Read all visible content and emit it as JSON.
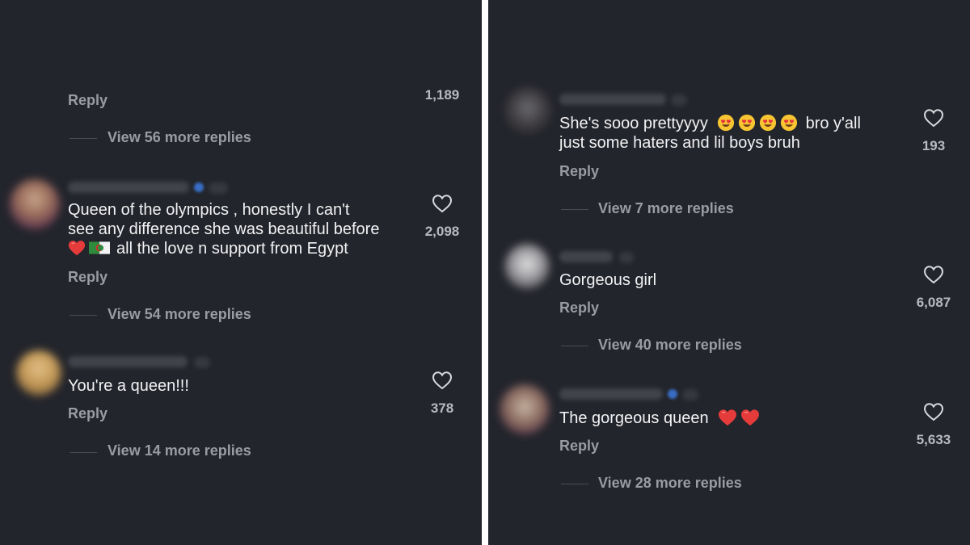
{
  "left": {
    "top_fragment": {
      "reply_label": "Reply",
      "like_count": "1,189",
      "view_more": "View 56 more replies"
    },
    "comments": [
      {
        "lines": [
          "Queen of the olympics , honestly I can't",
          "see any difference she was beautiful before",
          "all the love n support from Egypt"
        ],
        "reply_label": "Reply",
        "like_count": "2,098",
        "view_more": "View 54 more replies"
      },
      {
        "lines": [
          "You're a queen!!!"
        ],
        "reply_label": "Reply",
        "like_count": "378",
        "view_more": "View 14 more replies"
      }
    ]
  },
  "right": {
    "comments": [
      {
        "line1_start": "She's sooo prettyyyy",
        "line1_end": "bro y'all",
        "line2": "just some haters and lil boys bruh",
        "reply_label": "Reply",
        "like_count": "193",
        "view_more": "View 7 more replies"
      },
      {
        "lines": [
          "Gorgeous girl"
        ],
        "reply_label": "Reply",
        "like_count": "6,087",
        "view_more": "View 40 more replies"
      },
      {
        "lines": [
          "The gorgeous queen"
        ],
        "reply_label": "Reply",
        "like_count": "5,633",
        "view_more": "View 28 more replies"
      }
    ]
  },
  "icons": [
    "heart-outline-icon",
    "red-heart-emoji",
    "heart-eyes-emoji",
    "flag-emoji",
    "verified-badge-icon"
  ],
  "colors": {
    "background": "#23252c",
    "text": "#f2f2f4",
    "muted": "#9a9ca3",
    "divider": "#ffffff"
  }
}
